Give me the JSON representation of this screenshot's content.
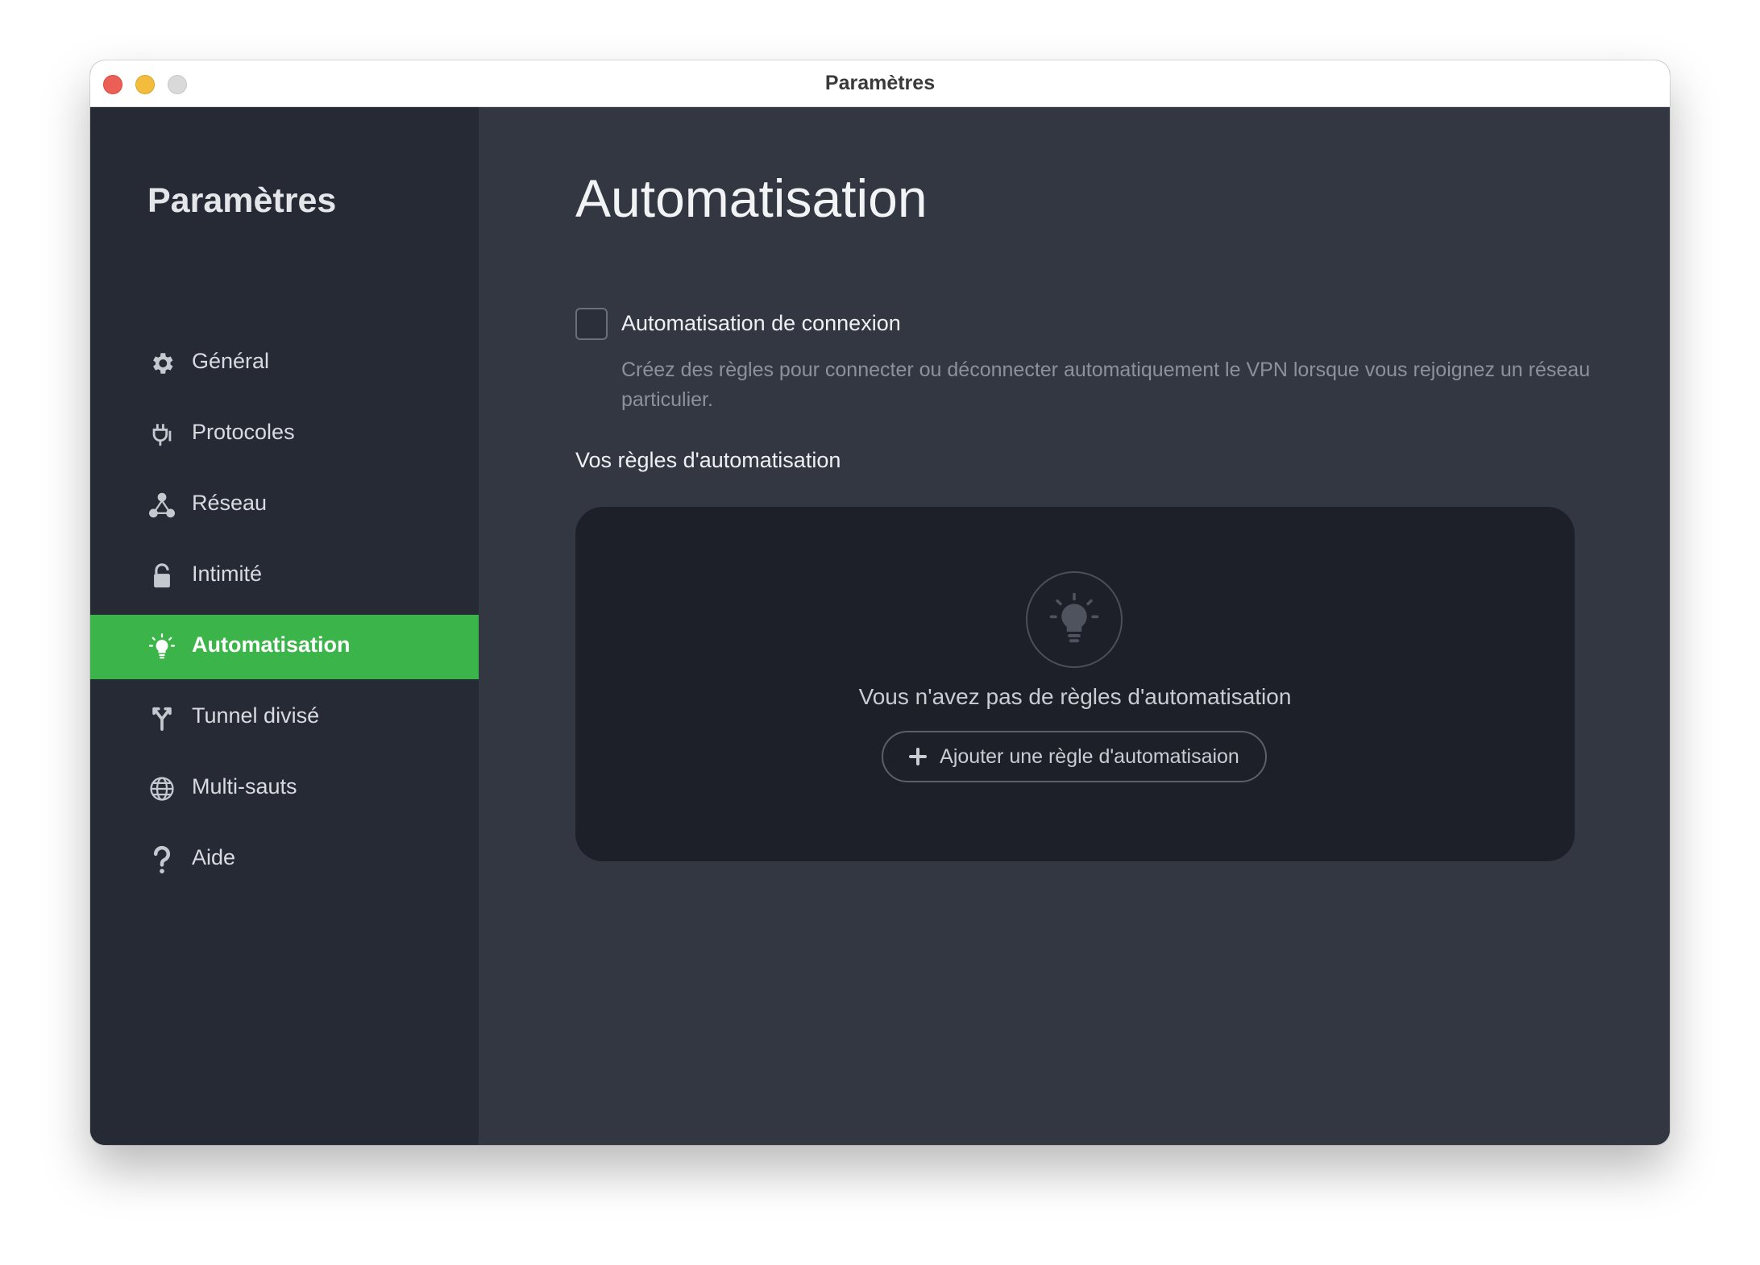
{
  "window": {
    "title": "Paramètres"
  },
  "sidebar": {
    "title": "Paramètres",
    "items": [
      {
        "label": "Général",
        "icon": "gear-icon",
        "active": false
      },
      {
        "label": "Protocoles",
        "icon": "plug-icon",
        "active": false
      },
      {
        "label": "Réseau",
        "icon": "network-icon",
        "active": false
      },
      {
        "label": "Intimité",
        "icon": "lock-icon",
        "active": false
      },
      {
        "label": "Automatisation",
        "icon": "lightbulb-icon",
        "active": true
      },
      {
        "label": "Tunnel divisé",
        "icon": "split-tunnel-icon",
        "active": false
      },
      {
        "label": "Multi-sauts",
        "icon": "globe-icon",
        "active": false
      },
      {
        "label": "Aide",
        "icon": "question-icon",
        "active": false
      }
    ]
  },
  "main": {
    "title": "Automatisation",
    "connection_automation": {
      "label": "Automatisation de connexion",
      "checked": false,
      "description": "Créez des règles pour connecter ou déconnecter automatiquement le VPN lorsque vous rejoignez un réseau particulier."
    },
    "rules_heading": "Vos règles d'automatisation",
    "empty_state": {
      "icon": "lightbulb-icon",
      "message": "Vous n'avez pas de règles d'automatisation",
      "add_button_label": "Ajouter une règle d'automatisaion"
    }
  },
  "colors": {
    "accent": "#3bb54a",
    "sidebar_bg": "#262a35",
    "main_bg": "#333742",
    "panel_bg": "#1d2028"
  }
}
